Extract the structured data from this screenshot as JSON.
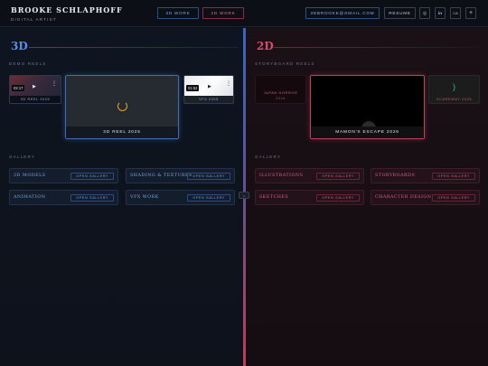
{
  "header": {
    "name": "BROOKE SCHLAPHOFF",
    "role": "DIGITAL ARTIST",
    "nav_3d": "3D WORK",
    "nav_2d": "2D WORK",
    "email": "3DBROOKE@GMAIL.COM",
    "resume": "RESUME",
    "icons": [
      "globe-icon",
      "linkedin-icon",
      "ca-text",
      "plus-icon"
    ],
    "icon_glyphs": {
      "globe": "◎",
      "linkedin": "in",
      "ca": "CA",
      "plus": "+"
    }
  },
  "left": {
    "title": "3D",
    "reels_label": "DEMO REELS",
    "reel_left": {
      "time": "02:17",
      "caption": "3D REEL 2025"
    },
    "reel_main": {
      "caption": "3D REEL 2025"
    },
    "reel_right": {
      "time": "01:52",
      "caption": "VFX 2025"
    },
    "gallery_label": "GALLERY",
    "gallery": [
      {
        "name": "3D MODELS",
        "button": "OPEN GALLERY"
      },
      {
        "name": "SHADING & TEXTURES",
        "button": "OPEN GALLERY"
      },
      {
        "name": "ANIMATION",
        "button": "OPEN GALLERY"
      },
      {
        "name": "VFX WORK",
        "button": "OPEN GALLERY"
      }
    ]
  },
  "right": {
    "title": "2D",
    "reels_label": "STORYBOARD REELS",
    "story_left": {
      "line1": "JAPAN HORROR",
      "line2": "2026"
    },
    "story_main": {
      "caption": "MAMON'S ESCAPE 2026"
    },
    "story_right": {
      "caption": "SCAREWAY 2025"
    },
    "gallery_label": "GALLERY",
    "gallery": [
      {
        "name": "ILLUSTRATIONS",
        "button": "OPEN GALLERY"
      },
      {
        "name": "STORYBOARDS",
        "button": "OPEN GALLERY"
      },
      {
        "name": "SKETCHES",
        "button": "OPEN GALLERY"
      },
      {
        "name": "CHARACTER DESIGN",
        "button": "OPEN GALLERY"
      }
    ]
  },
  "divider_handle": "⇔",
  "colors": {
    "accent_3d": "#5c8fe6",
    "accent_2d": "#e04a6a",
    "loader": "#e2a52a"
  }
}
